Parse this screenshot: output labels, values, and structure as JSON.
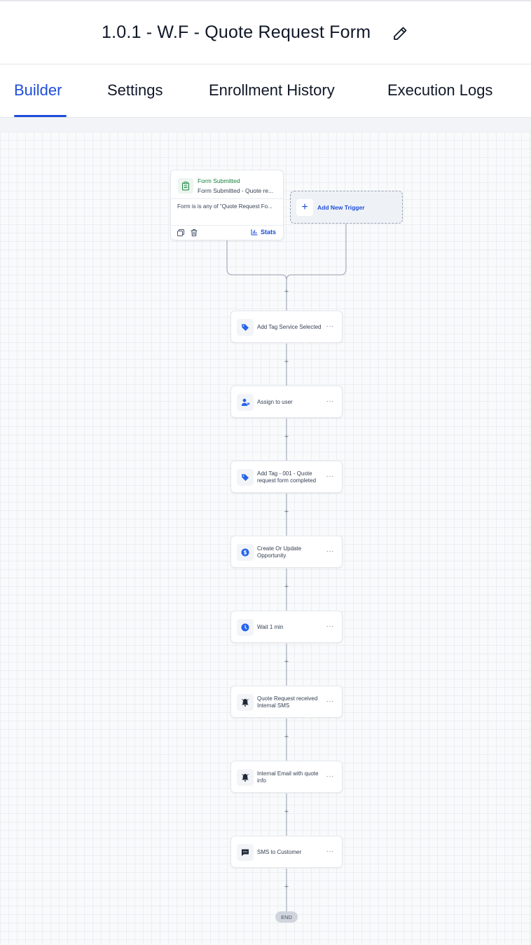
{
  "header": {
    "title": "1.0.1 - W.F - Quote Request Form",
    "edit_icon": "pencil-icon"
  },
  "tabs": [
    {
      "label": "Builder",
      "active": true
    },
    {
      "label": "Settings",
      "active": false
    },
    {
      "label": "Enrollment History",
      "active": false
    },
    {
      "label": "Execution Logs",
      "active": false
    }
  ],
  "trigger": {
    "icon": "clipboard-icon",
    "title": "Form Submitted",
    "subtitle": "Form Submitted - Quote re...",
    "description": "Form is is any of \"Quote Request Fo...",
    "stats_label": "Stats"
  },
  "add_trigger": {
    "label": "Add New Trigger"
  },
  "actions": [
    {
      "label": "Add Tag Service Selected",
      "icon": "tag-icon"
    },
    {
      "label": "Assign to user",
      "icon": "user-assign-icon"
    },
    {
      "label": "Add Tag - 001 - Quote request form completed",
      "icon": "tag-icon"
    },
    {
      "label": "Create Or Update Opportunity",
      "icon": "dollar-icon"
    },
    {
      "label": "Wait 1 min",
      "icon": "clock-icon"
    },
    {
      "label": "Quote Request received Internal SMS",
      "icon": "bell-icon"
    },
    {
      "label": "Internal Email with quote info",
      "icon": "bell-icon"
    },
    {
      "label": "SMS to Customer",
      "icon": "message-icon"
    }
  ],
  "menu_glyph": "···",
  "plus_glyph": "+",
  "end_label": "END",
  "colors": {
    "accent": "#1d4ed8",
    "trigger_title": "#15803d",
    "icon_blue": "#2563eb",
    "icon_dark": "#1f2937"
  }
}
